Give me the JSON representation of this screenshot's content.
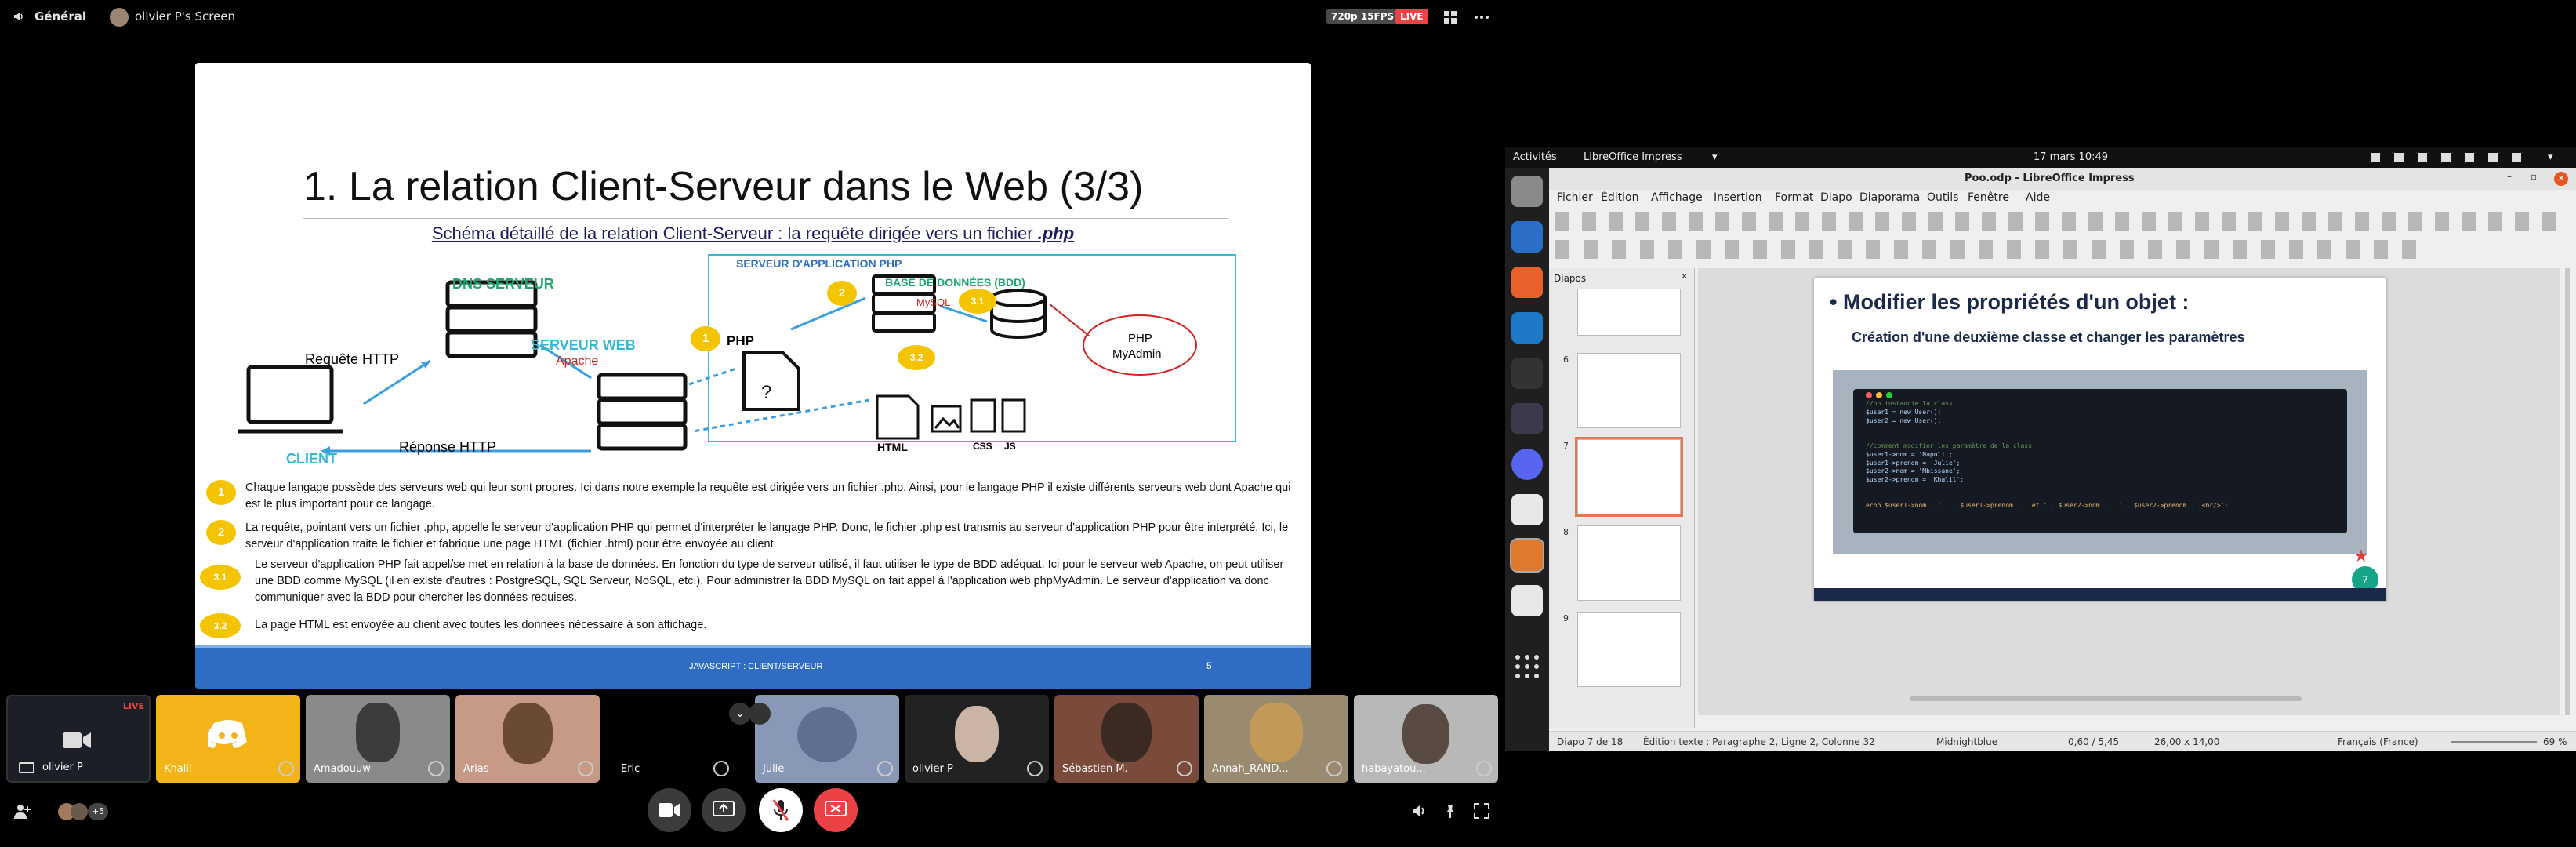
{
  "topbar": {
    "channel": "Général",
    "screen_owner": "olivier P's Screen",
    "quality": "720p 15FPS",
    "live": "LIVE"
  },
  "slide": {
    "title": "1. La relation Client-Serveur dans le Web (3/3)",
    "subtitle_pre": "Schéma détaillé de la relation Client-Serveur : la requête dirigée vers un fichier ",
    "subtitle_ext": ".php",
    "dns": "DNS SERVEUR",
    "req": "Requête HTTP",
    "resp": "Réponse HTTP",
    "webserver": "SERVEUR WEB",
    "apache": "Apache",
    "appserver": "SERVEUR D'APPLICATION PHP",
    "bdd": "BASE DE DONNÉES (BDD)",
    "mysql": "MySQL",
    "phpmyadmin_1": "PHP",
    "phpmyadmin_2": "MyAdmin",
    "client": "CLIENT",
    "php_file": "PHP",
    "html_file": "HTML",
    "css_file": "CSS",
    "js_file": "JS",
    "b1": "1",
    "b2": "2",
    "b31": "3.1",
    "b32": "3.2",
    "notes": [
      {
        "n": "1",
        "text": "Chaque langage possède des serveurs web qui leur sont propres. Ici dans notre exemple la requête est dirigée vers un fichier .php. Ainsi, pour le langage PHP il existe différents serveurs web dont Apache qui est le plus important pour ce langage."
      },
      {
        "n": "2",
        "text": "La requête, pointant vers un fichier .php, appelle le serveur d'application PHP qui permet d'interpréter le langage PHP. Donc, le fichier .php est transmis au serveur d'application PHP pour être interprété. Ici, le serveur d'application traite le fichier et fabrique une page HTML (fichier .html) pour être envoyée au client."
      },
      {
        "n": "3.1",
        "text": "Le serveur d'application PHP fait appel/se met en relation à la base de données. En fonction du type de serveur utilisé, il faut utiliser le type de BDD adéquat. Ici pour le serveur web Apache, on peut utiliser une BDD comme MySQL (il en existe d'autres : PostgreSQL, SQL Serveur, NoSQL, etc.). Pour administrer la BDD MySQL on fait appel à l'application web phpMyAdmin. Le serveur d'application va donc communiquer avec la BDD pour chercher les données requises."
      },
      {
        "n": "3.2",
        "text": "La page HTML est envoyée au client avec toutes les données nécessaire à son affichage."
      }
    ],
    "footer": "JAVASCRIPT : CLIENT/SERVEUR",
    "page": "5"
  },
  "participants": [
    {
      "name": "olivier P",
      "live": "LIVE"
    },
    {
      "name": "Khalil"
    },
    {
      "name": "Amadouuw"
    },
    {
      "name": "Arias"
    },
    {
      "name": "Eric"
    },
    {
      "name": "Julie"
    },
    {
      "name": "olivier P"
    },
    {
      "name": "Sébastien M."
    },
    {
      "name": "Annah_RAND..."
    },
    {
      "name": "habayatou..."
    }
  ],
  "bottombar": {
    "plus_count": "+5"
  },
  "ubuntu": {
    "activities": "Activités",
    "app": "LibreOffice Impress",
    "clock": "17 mars  10:49",
    "window_title": "Poo.odp - LibreOffice Impress",
    "menus": [
      "Fichier",
      "Édition",
      "Affichage",
      "Insertion",
      "Format",
      "Diapo",
      "Diaporama",
      "Outils",
      "Fenêtre",
      "Aide"
    ],
    "panel_title": "Diapos",
    "slide_numbers": [
      "6",
      "7",
      "8",
      "9"
    ],
    "impress_slide": {
      "heading": "Modifier les propriétés d'un objet :",
      "sub": "Création d'une deuxième classe  et changer les paramètres",
      "code": [
        "//on instancie la class",
        "$user1 = new User();",
        "$user2 = new User();",
        "",
        "",
        "//comment modifier les paramètre de la class",
        "$user1->nom = 'Napoli';",
        "$user1->prenom = 'Julie';",
        "$user2->nom = 'Mbissane';",
        "$user2->prenom = 'Khalil';",
        "",
        "",
        "echo $user1->nom . ' ' . $user1->prenom . ' et ' . $user2->nom . ' ' . $user2->prenom . '<br/>';"
      ],
      "page": "7"
    },
    "status": {
      "slide": "Diapo 7 de 18",
      "edit": "Édition texte : Paragraphe 2, Ligne 2, Colonne 32",
      "theme": "Midnightblue",
      "pos": "0,60 / 5,45",
      "size": "26,00 x 14,00",
      "lang": "Français (France)",
      "zoom": "69 %"
    }
  }
}
